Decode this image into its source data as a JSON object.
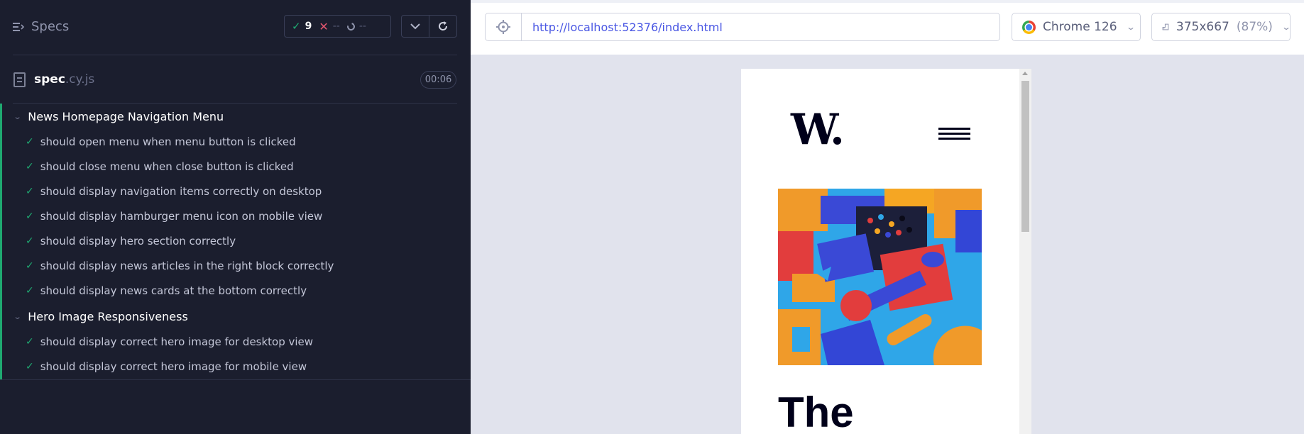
{
  "reporter": {
    "specs_label": "Specs",
    "stats": {
      "passed": "9",
      "failed": "--",
      "pending": "--"
    },
    "file": {
      "name": "spec",
      "ext": ".cy.js",
      "duration": "00:06"
    },
    "suites": [
      {
        "title": "News Homepage Navigation Menu",
        "tests": [
          "should open menu when menu button is clicked",
          "should close menu when close button is clicked",
          "should display navigation items correctly on desktop",
          "should display hamburger menu icon on mobile view",
          "should display hero section correctly",
          "should display news articles in the right block correctly",
          "should display news cards at the bottom correctly"
        ]
      },
      {
        "title": "Hero Image Responsiveness",
        "tests": [
          "should display correct hero image for desktop view",
          "should display correct hero image for mobile view"
        ]
      }
    ]
  },
  "aut": {
    "url": "http://localhost:52376/index.html",
    "browser": "Chrome 126",
    "viewport_size": "375x667",
    "viewport_scale": "(87%)"
  },
  "site": {
    "logo": "W.",
    "hero_title": "The"
  },
  "colors": {
    "pass": "#1fa971",
    "fail": "#e45770",
    "url": "#4956e3",
    "reporter_bg": "#1b1e2e",
    "aut_bg": "#e1e3ed"
  }
}
